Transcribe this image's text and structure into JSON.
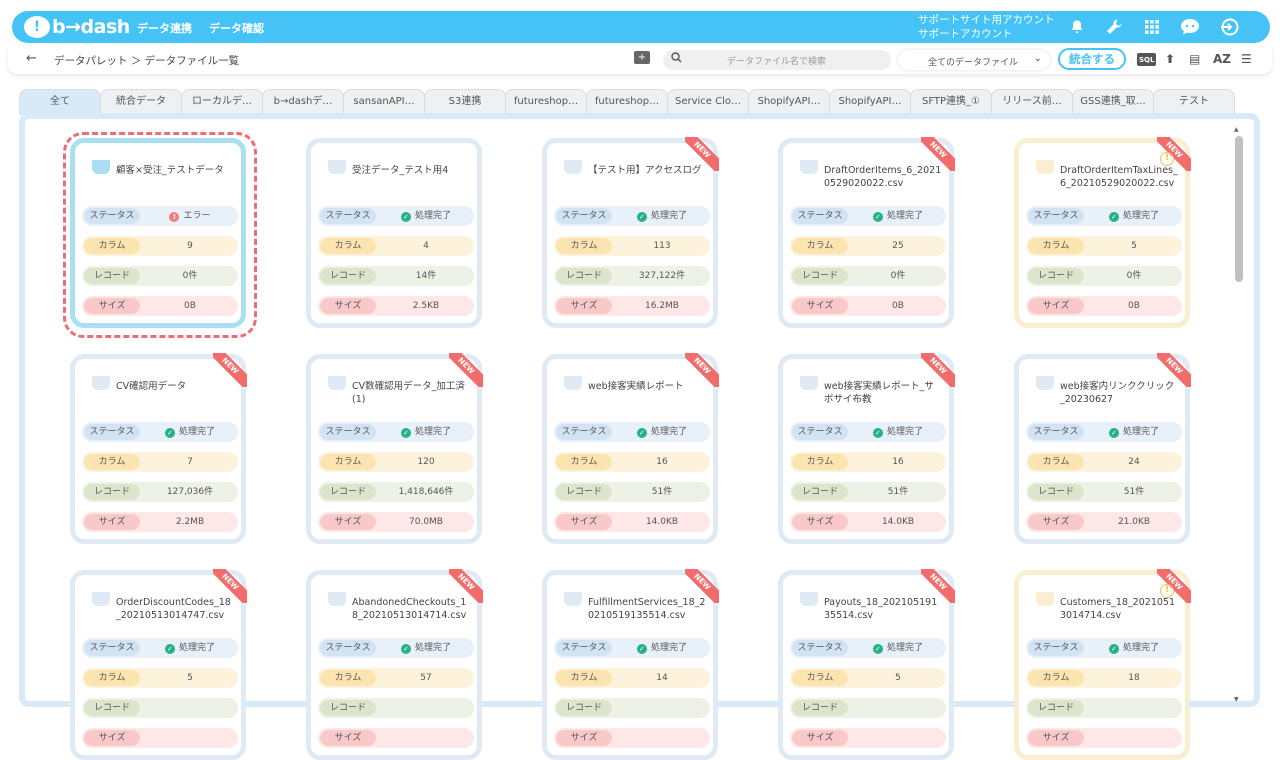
{
  "app": {
    "logo_text": "b→dash",
    "logo_mark": "!"
  },
  "nav": [
    {
      "label": "データ連携"
    },
    {
      "label": "データ確認"
    }
  ],
  "account": {
    "line1": "サポートサイト用アカウント",
    "line2": "サポートアカウント"
  },
  "header_icons": [
    "bell-icon",
    "wrench-icon",
    "grid-icon",
    "chat-bubble-icon",
    "logout-icon"
  ],
  "breadcrumb": {
    "back": "←",
    "text": "データパレット ＞ データファイル一覧"
  },
  "search": {
    "placeholder": "データファイル名で検索",
    "icon": "🔍"
  },
  "file_filter": {
    "value": "全てのデータファイル",
    "chevron": "⌄"
  },
  "merge_button": "統合する",
  "toolbar_icons": {
    "sql": "SQL",
    "upload": "⬆",
    "list": "▤",
    "sort": "AZ",
    "menu": "☰"
  },
  "tabs": [
    "全て",
    "統合データ",
    "ローカルデ…",
    "b→dashデ…",
    "sansanAPI…",
    "S3連携",
    "futureshop…",
    "futureshop…",
    "Service Clo…",
    "ShopifyAPI…",
    "ShopifyAPI…",
    "SFTP連携_①",
    "リリース前…",
    "GSS連携_取…",
    "テスト"
  ],
  "labels": {
    "status": "ステータス",
    "column": "カラム",
    "record": "レコード",
    "size": "サイズ"
  },
  "new_label": "NEW",
  "status_icons": {
    "done": "✓",
    "error": "!"
  },
  "cards": [
    {
      "title": "顧客×受注_テストデータ",
      "status": "エラー",
      "status_type": "error",
      "columns": "9",
      "records": "0件",
      "size": "0B",
      "new": false,
      "variant": "selected"
    },
    {
      "title": "受注データ_テスト用4",
      "status": "処理完了",
      "status_type": "done",
      "columns": "4",
      "records": "14件",
      "size": "2.5KB",
      "new": false,
      "variant": "normal"
    },
    {
      "title": "【テスト用】アクセスログ",
      "status": "処理完了",
      "status_type": "done",
      "columns": "113",
      "records": "327,122件",
      "size": "16.2MB",
      "new": true,
      "variant": "normal"
    },
    {
      "title": "DraftOrderItems_6_20210529020022.csv",
      "status": "処理完了",
      "status_type": "done",
      "columns": "25",
      "records": "0件",
      "size": "0B",
      "new": true,
      "variant": "normal"
    },
    {
      "title": "DraftOrderItemTaxLines_6_20210529020022.csv",
      "status": "処理完了",
      "status_type": "done",
      "columns": "5",
      "records": "0件",
      "size": "0B",
      "new": true,
      "variant": "yellow"
    },
    {
      "title": "CV確認用データ",
      "status": "処理完了",
      "status_type": "done",
      "columns": "7",
      "records": "127,036件",
      "size": "2.2MB",
      "new": true,
      "variant": "normal"
    },
    {
      "title": "CV数確認用データ_加工済(1)",
      "status": "処理完了",
      "status_type": "done",
      "columns": "120",
      "records": "1,418,646件",
      "size": "70.0MB",
      "new": true,
      "variant": "normal"
    },
    {
      "title": "web接客実績レポート",
      "status": "処理完了",
      "status_type": "done",
      "columns": "16",
      "records": "51件",
      "size": "14.0KB",
      "new": true,
      "variant": "normal"
    },
    {
      "title": "web接客実績レポート_サポサイ布教",
      "status": "処理完了",
      "status_type": "done",
      "columns": "16",
      "records": "51件",
      "size": "14.0KB",
      "new": true,
      "variant": "normal"
    },
    {
      "title": "web接客内リンククリック_20230627",
      "status": "処理完了",
      "status_type": "done",
      "columns": "24",
      "records": "51件",
      "size": "21.0KB",
      "new": true,
      "variant": "normal"
    },
    {
      "title": "OrderDiscountCodes_18_20210513014747.csv",
      "status": "処理完了",
      "status_type": "done",
      "columns": "5",
      "records": "",
      "size": "",
      "new": true,
      "variant": "normal"
    },
    {
      "title": "AbandonedCheckouts_18_20210513014714.csv",
      "status": "処理完了",
      "status_type": "done",
      "columns": "57",
      "records": "",
      "size": "",
      "new": true,
      "variant": "normal"
    },
    {
      "title": "FulfillmentServices_18_20210519135514.csv",
      "status": "処理完了",
      "status_type": "done",
      "columns": "14",
      "records": "",
      "size": "",
      "new": true,
      "variant": "normal"
    },
    {
      "title": "Payouts_18_20210519135514.csv",
      "status": "処理完了",
      "status_type": "done",
      "columns": "5",
      "records": "",
      "size": "",
      "new": true,
      "variant": "normal"
    },
    {
      "title": "Customers_18_20210513014714.csv",
      "status": "処理完了",
      "status_type": "done",
      "columns": "18",
      "records": "",
      "size": "",
      "new": true,
      "variant": "yellow"
    }
  ]
}
